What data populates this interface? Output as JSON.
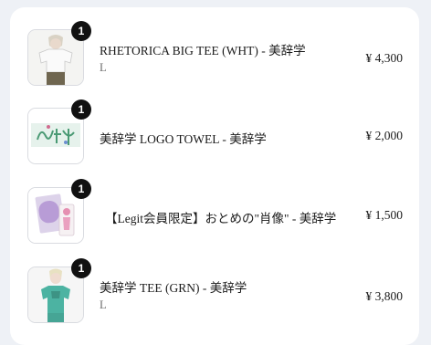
{
  "items": [
    {
      "quantity": "1",
      "name": "RHETORICA BIG TEE (WHT) - 美辞学",
      "variant": "L",
      "price": "¥ 4,300"
    },
    {
      "quantity": "1",
      "name": "美辞学 LOGO TOWEL - 美辞学",
      "variant": "",
      "price": "¥ 2,000"
    },
    {
      "quantity": "1",
      "name": "【Legit会員限定】おとめの\"肖像\" - 美辞学",
      "variant": "",
      "price": "¥ 1,500"
    },
    {
      "quantity": "1",
      "name": "美辞学 TEE (GRN) - 美辞学",
      "variant": "L",
      "price": "¥ 3,800"
    }
  ]
}
